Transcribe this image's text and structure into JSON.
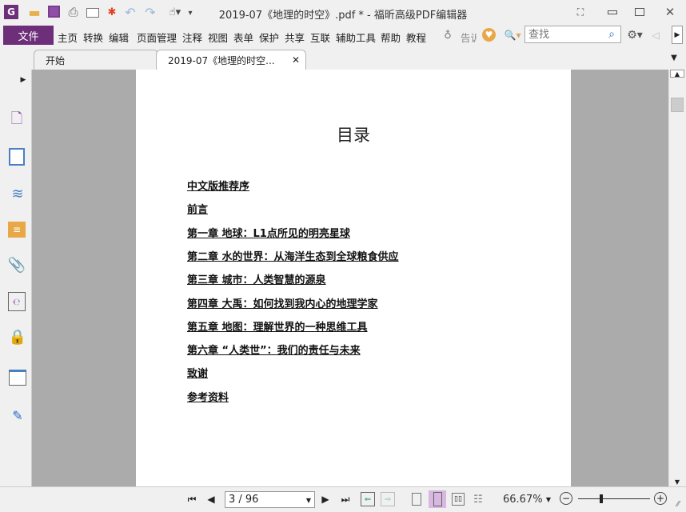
{
  "window": {
    "title": "2019-07《地理的时空》.pdf * - 福昕高级PDF编辑器"
  },
  "menu": {
    "file": "文件",
    "items": [
      "主页",
      "转换",
      "编辑",
      "页面管理",
      "注释",
      "视图",
      "表单",
      "保护",
      "共享",
      "互联",
      "辅助工具",
      "帮助",
      "教程"
    ],
    "tell_me": "告诉",
    "search_placeholder": "查找"
  },
  "tabs": [
    {
      "label": "开始"
    },
    {
      "label": "2019-07《地理的时空..."
    }
  ],
  "document": {
    "title": "目录",
    "toc": [
      "中文版推荐序",
      "前言",
      "第一章 地球：L1点所见的明亮星球",
      "第二章 水的世界：从海洋生态到全球粮食供应",
      "第三章 城市：人类智慧的源泉",
      "第四章 大禹：如何找到我内心的地理学家",
      "第五章 地图：理解世界的一种思维工具",
      "第六章 “人类世”：我们的责任与未来",
      "致谢",
      "参考资料"
    ]
  },
  "status": {
    "page": "3 / 96",
    "zoom": "66.67%",
    "zoom_slider_percent": 66.67
  },
  "colors": {
    "accent": "#6d2e7a",
    "highlight": "#d8b7e0",
    "viewer_bg": "#ababab"
  }
}
